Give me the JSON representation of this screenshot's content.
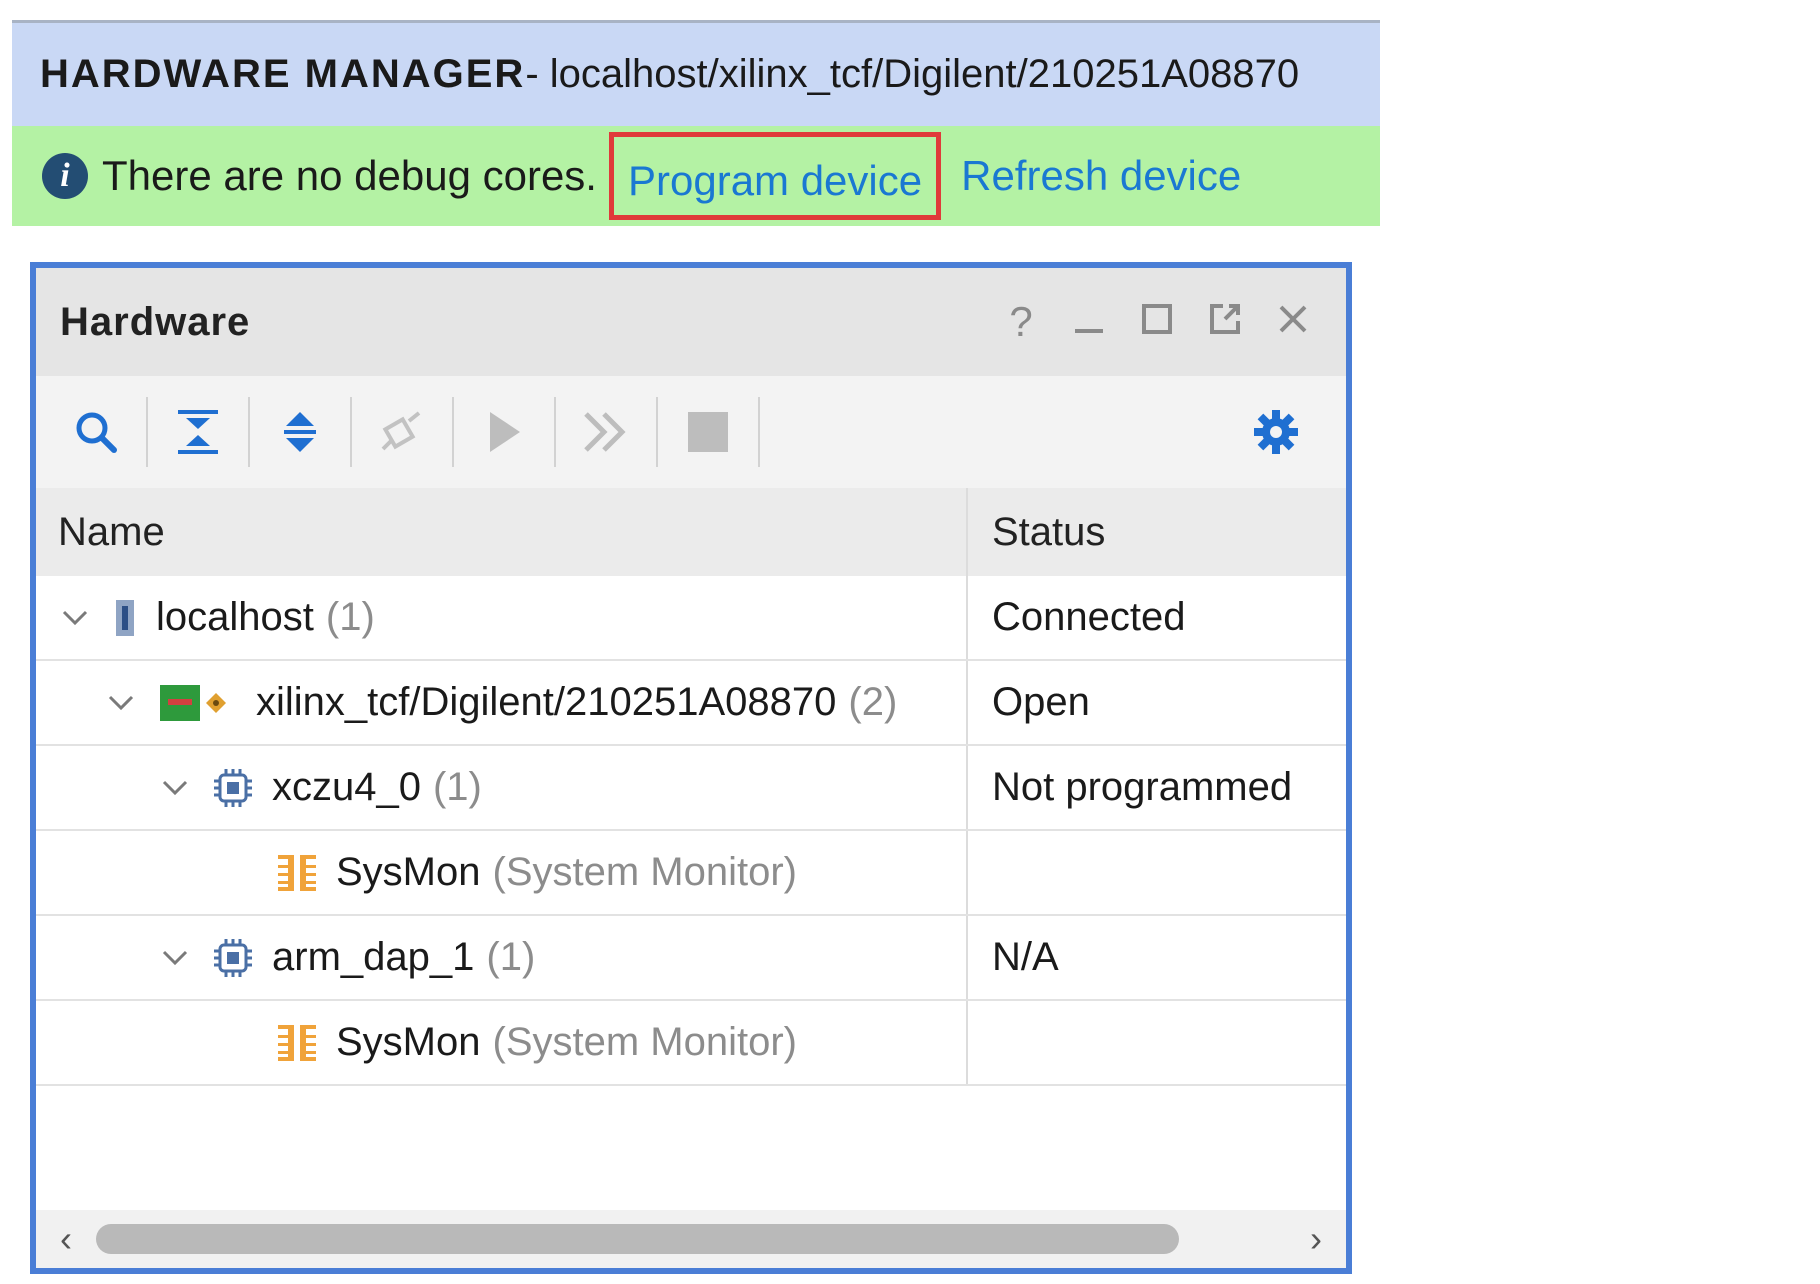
{
  "header": {
    "title_bold": "HARDWARE MANAGER",
    "title_rest": " - localhost/xilinx_tcf/Digilent/210251A08870"
  },
  "banner": {
    "message": "There are no debug cores.",
    "program_link": "Program device",
    "refresh_link": "Refresh device"
  },
  "panel": {
    "title": "Hardware",
    "header_icons": [
      "help-icon",
      "minimize-icon",
      "maximize-icon",
      "float-icon",
      "close-icon"
    ],
    "help_glyph": "?",
    "toolbar_icons": [
      "search-icon",
      "collapse-all-icon",
      "expand-all-icon",
      "auto-connect-icon",
      "run-icon",
      "run-all-icon",
      "stop-icon",
      "gear-icon"
    ],
    "columns": {
      "name": "Name",
      "status": "Status"
    },
    "rows": [
      {
        "name": "localhost",
        "count": "(1)",
        "status": "Connected",
        "icon": "server-icon"
      },
      {
        "name": "xilinx_tcf/Digilent/210251A08870",
        "count": "(2)",
        "status": "Open",
        "icon": "board-icon"
      },
      {
        "name": "xczu4_0",
        "count": "(1)",
        "status": "Not programmed",
        "icon": "chip-icon"
      },
      {
        "name": "SysMon",
        "sub": "(System Monitor)",
        "status": "",
        "icon": "sysmon-icon"
      },
      {
        "name": "arm_dap_1",
        "count": "(1)",
        "status": "N/A",
        "icon": "chip-icon"
      },
      {
        "name": "SysMon",
        "sub": "(System Monitor)",
        "status": "",
        "icon": "sysmon-icon"
      }
    ]
  },
  "colors": {
    "title_bar": "#c9d8f5",
    "banner": "#b4f2a4",
    "link": "#1a78d2",
    "highlight_box": "#e03a3a",
    "panel_border": "#4a7ed6",
    "icon_blue": "#1f6fd1"
  }
}
